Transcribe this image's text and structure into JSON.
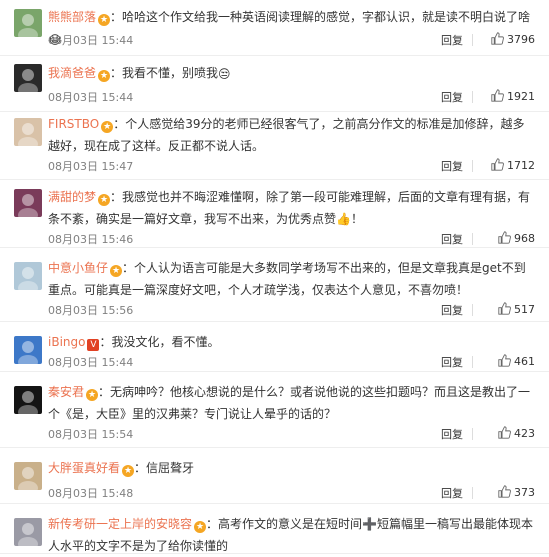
{
  "ui": {
    "reply_label": "回复"
  },
  "comments": [
    {
      "user": "熊熊部落",
      "text": "哈哈这个作文给我一种英语阅读理解的感觉，字都认识，就是读不明白说了啥",
      "emoji": "😂",
      "time": "08月03日 15:44",
      "likes": "3796"
    },
    {
      "user": "我滴爸爸",
      "text": "我看不懂，别喷我",
      "emoji": "😒",
      "time": "08月03日 15:44",
      "likes": "1921"
    },
    {
      "user": "FIRSTBO",
      "text": "个人感觉给39分的老师已经很客气了，之前高分作文的标准是加修辞，越多越好，现在成了这样。反正都不说人话。",
      "emoji": "",
      "time": "08月03日 15:47",
      "likes": "1712"
    },
    {
      "user": "满甜的梦",
      "text": "我感觉也并不晦涩难懂啊，除了第一段可能难理解，后面的文章有理有据，有条不紊，确实是一篇好文章，我写不出来，为优秀点赞👍！",
      "emoji": "",
      "time": "08月03日 15:46",
      "likes": "968"
    },
    {
      "user": "中意小鱼仔",
      "text": "个人认为语言可能是大多数同学考场写不出来的，但是文章我真是get不到重点。可能真是一篇深度好文吧，个人才疏学浅，仅表达个人意见，不喜勿喷！",
      "emoji": "",
      "time": "08月03日 15:56",
      "likes": "517"
    },
    {
      "user": "iBingo",
      "text": "我没文化，看不懂。",
      "emoji": "",
      "time": "08月03日 15:44",
      "likes": "461"
    },
    {
      "user": "秦安君",
      "text": "无病呻吟？他核心想说的是什么？或者说他说的这些扣题吗？而且这是教出了一个《是，大臣》里的汉弗莱？专门说让人晕乎的话的？",
      "emoji": "",
      "time": "08月03日 15:54",
      "likes": "423"
    },
    {
      "user": "大胖蛋真好看",
      "text": "信屈聱牙",
      "emoji": "",
      "time": "08月03日 15:48",
      "likes": "373"
    },
    {
      "user": "新传考研一定上岸的安晓容",
      "text": "高考作文的意义是在短时间➕短篇幅里一稿写出最能体现本人水平的文字不是为了给你读懂的",
      "emoji": "",
      "time": "",
      "likes": ""
    }
  ],
  "colors": {
    "username": "#eb7350",
    "vip_badge": "#f5a623",
    "v_badge": "#e14123"
  }
}
